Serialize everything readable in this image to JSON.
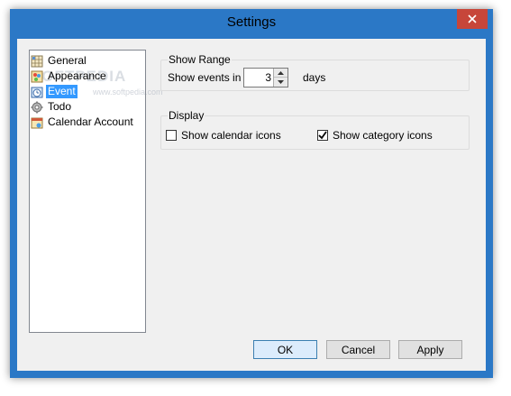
{
  "window": {
    "title": "Settings"
  },
  "tree": {
    "items": [
      {
        "label": "General",
        "icon": "grid-settings-icon"
      },
      {
        "label": "Appearance",
        "icon": "palette-icon"
      },
      {
        "label": "Event",
        "icon": "calendar-clock-icon",
        "selected": true
      },
      {
        "label": "Todo",
        "icon": "gear-icon"
      },
      {
        "label": "Calendar Account",
        "icon": "calendar-account-icon"
      }
    ],
    "watermark": "SOFTPEDIA",
    "watermark_url": "www.softpedia.com"
  },
  "show_range": {
    "title": "Show Range",
    "label": "Show events in",
    "value": "3",
    "unit": "days"
  },
  "display": {
    "title": "Display",
    "calendar_icons": {
      "label": "Show calendar icons",
      "checked": false
    },
    "category_icons": {
      "label": "Show category icons",
      "checked": true
    }
  },
  "buttons": {
    "ok": "OK",
    "cancel": "Cancel",
    "apply": "Apply"
  },
  "colors": {
    "titlebar": "#2b78c6",
    "close": "#c7463a",
    "selection": "#3399ff"
  }
}
